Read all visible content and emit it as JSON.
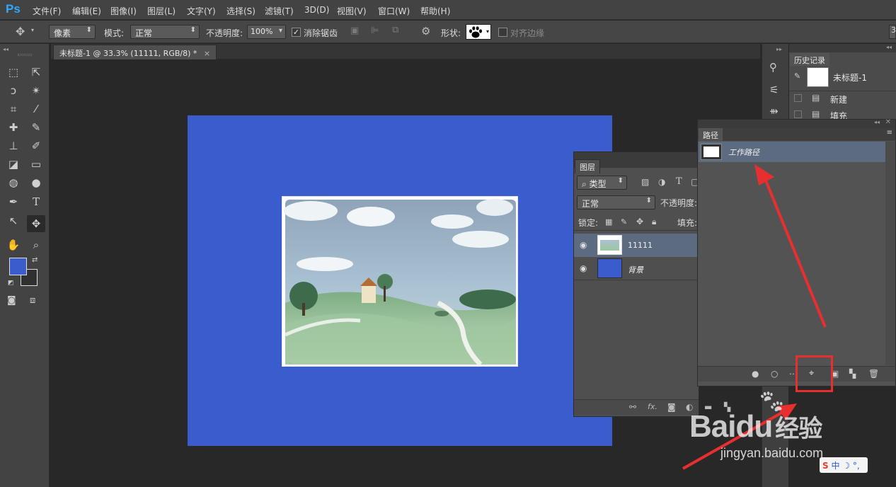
{
  "app": {
    "logo": "Ps",
    "menu": [
      "文件(F)",
      "编辑(E)",
      "图像(I)",
      "图层(L)",
      "文字(Y)",
      "选择(S)",
      "滤镜(T)",
      "3D(D)",
      "视图(V)",
      "窗口(W)",
      "帮助(H)"
    ]
  },
  "options": {
    "tool_mode": "像素",
    "mode_label": "模式:",
    "mode_value": "正常",
    "opacity_label": "不透明度:",
    "opacity_value": "100%",
    "antialias_label": "消除锯齿",
    "shape_label": "形状:",
    "align_edges_label": "对齐边缘",
    "right_glyph": "3"
  },
  "document": {
    "tab_title": "未标题-1 @ 33.3% (11111, RGB/8) *",
    "canvas_color": "#3a5ccc"
  },
  "colors": {
    "foreground": "#3a5ccc",
    "background": "#ffffff",
    "accent_red": "#e82f2f"
  },
  "history": {
    "tab": "历史记录",
    "snapshot_label": "未标题-1",
    "items": [
      "新建",
      "填充"
    ]
  },
  "layers": {
    "tab": "图层",
    "filter_type": "类型",
    "blend_mode": "正常",
    "opacity_label": "不透明度:",
    "lock_label": "锁定:",
    "fill_label": "填充:",
    "items": [
      {
        "name": "11111",
        "selected": true
      },
      {
        "name": "背景",
        "selected": false
      }
    ],
    "footer_fx": "fx."
  },
  "paths": {
    "tab": "路径",
    "items": [
      {
        "name": "工作路径",
        "selected": true
      }
    ]
  },
  "watermark": {
    "brand_text": "Baidu",
    "brand_cn": "经验",
    "url": "jingyan.baidu.com",
    "ime": "中"
  }
}
